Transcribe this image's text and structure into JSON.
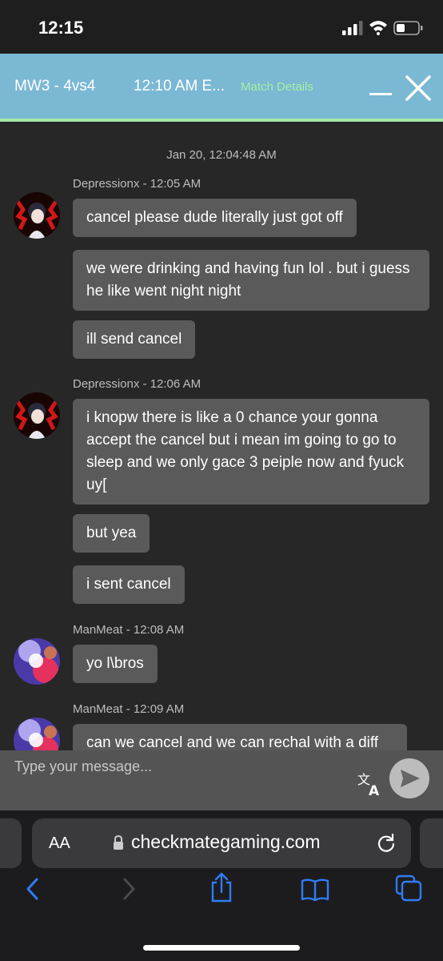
{
  "status_bar": {
    "time": "12:15"
  },
  "header": {
    "title": "MW3 - 4vs4",
    "time_label": "12:10 AM E...",
    "details_link": "Match Details"
  },
  "chat": {
    "date_stamp": "Jan 20, 12:04:48 AM",
    "groups": [
      {
        "sender": "Depressionx - 12:05 AM",
        "avatar": "anime-character-avatar",
        "messages": [
          "cancel please dude literally just got off",
          "we were drinking and having fun lol . but i guess he like went night night",
          "ill send cancel"
        ]
      },
      {
        "sender": "Depressionx - 12:06 AM",
        "avatar": "anime-character-avatar",
        "messages": [
          "i knopw there is like a 0 chance your gonna accept the cancel but i mean im going to go to sleep and we only gace 3 peiple now and fyuck uy[",
          "but yea",
          "i sent cancel"
        ]
      },
      {
        "sender": "ManMeat - 12:08 AM",
        "avatar": "neon-figure-avatar",
        "messages": [
          "yo l\\bros"
        ]
      },
      {
        "sender": "ManMeat - 12:09 AM",
        "avatar": "neon-figure-avatar",
        "messages": [
          "can we cancel and we can rechal with a diff"
        ]
      }
    ]
  },
  "input": {
    "placeholder": "Type your message..."
  },
  "browser": {
    "text_size_label": "AA",
    "url": "checkmategaming.com"
  },
  "colors": {
    "header_bg": "#7bb8d4",
    "header_accent": "#a4e8a6",
    "chat_bg": "#272727",
    "bubble_bg": "#5a5a5a",
    "safari_accent": "#2f7cf6"
  }
}
